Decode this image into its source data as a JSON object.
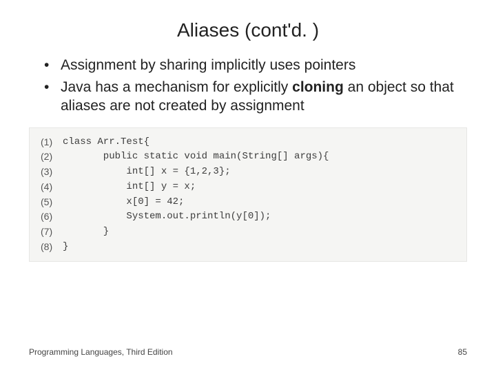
{
  "title": "Aliases (cont'd. )",
  "bullets": [
    {
      "text": "Assignment by sharing implicitly uses pointers"
    },
    {
      "pre": "Java has a mechanism for explicitly ",
      "bold": "cloning",
      "post": " an object so that aliases are not created by assignment"
    }
  ],
  "code": {
    "lines": [
      {
        "num": "(1)",
        "text": "class Arr.Test{"
      },
      {
        "num": "(2)",
        "text": "       public static void main(String[] args){"
      },
      {
        "num": "(3)",
        "text": "           int[] x = {1,2,3};"
      },
      {
        "num": "(4)",
        "text": "           int[] y = x;"
      },
      {
        "num": "(5)",
        "text": "           x[0] = 42;"
      },
      {
        "num": "(6)",
        "text": "           System.out.println(y[0]);"
      },
      {
        "num": "(7)",
        "text": "       }"
      },
      {
        "num": "(8)",
        "text": "}"
      }
    ]
  },
  "footer": {
    "left": "Programming Languages, Third Edition",
    "right": "85"
  }
}
